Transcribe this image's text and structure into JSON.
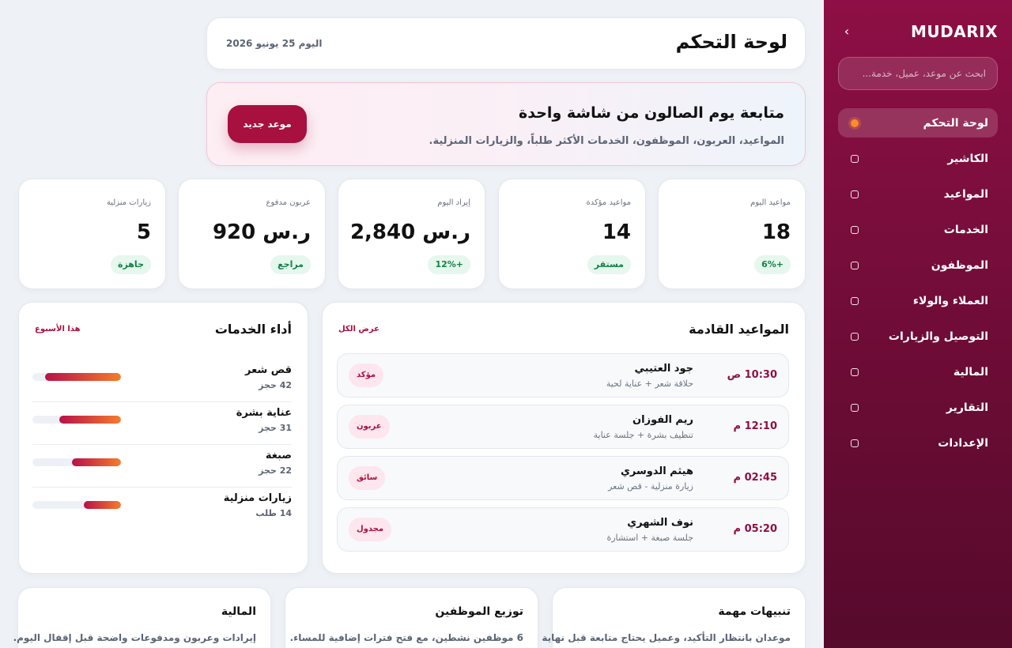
{
  "sidebar": {
    "brand": "MUDARIX",
    "collapse_icon": "chevron-right-icon",
    "search_placeholder": "ابحث عن موعد، عميل، خدمة...",
    "items": [
      {
        "label": "لوحة التحكم",
        "active": true
      },
      {
        "label": "الكاشير"
      },
      {
        "label": "المواعيد"
      },
      {
        "label": "الخدمات"
      },
      {
        "label": "الموظفون"
      },
      {
        "label": "العملاء والولاء"
      },
      {
        "label": "التوصيل والزيارات"
      },
      {
        "label": "المالية"
      },
      {
        "label": "التقارير"
      },
      {
        "label": "الإعدادات"
      }
    ]
  },
  "header": {
    "title": "لوحة التحكم",
    "date": "اليوم 25 يونيو 2026"
  },
  "hero": {
    "title": "متابعة يوم الصالون من شاشة واحدة",
    "subtitle": "المواعيد، العربون، الموظفون، الخدمات الأكثر طلباً، والزيارات المنزلية.",
    "button": "موعد جديد"
  },
  "stats": [
    {
      "label": "مواعيد اليوم",
      "value": "18",
      "badge": "+6%"
    },
    {
      "label": "مواعيد مؤكدة",
      "value": "14",
      "badge": "مستقر"
    },
    {
      "label": "إيراد اليوم",
      "value": "2,840 ر.س",
      "badge": "+12%"
    },
    {
      "label": "عربون مدفوع",
      "value": "920 ر.س",
      "badge": "مراجع"
    },
    {
      "label": "زيارات منزلية",
      "value": "5",
      "badge": "جاهزة"
    }
  ],
  "appointments": {
    "title": "المواعيد القادمة",
    "link": "عرض الكل",
    "items": [
      {
        "time": "10:30 ص",
        "name": "جود العتيبي",
        "desc": "حلاقة شعر + عناية لحية",
        "tag": "مؤكد"
      },
      {
        "time": "12:10 م",
        "name": "ريم الفوزان",
        "desc": "تنظيف بشرة + جلسة عناية",
        "tag": "عربون"
      },
      {
        "time": "02:45 م",
        "name": "هيثم الدوسري",
        "desc": "زيارة منزلية - قص شعر",
        "tag": "سائق"
      },
      {
        "time": "05:20 م",
        "name": "نوف الشهري",
        "desc": "جلسة صبغة + استشارة",
        "tag": "مجدول"
      }
    ]
  },
  "services": {
    "title": "أداء الخدمات",
    "link": "هذا الأسبوع",
    "items": [
      {
        "name": "قص شعر",
        "count": "42 حجز",
        "level": 0.86
      },
      {
        "name": "عناية بشرة",
        "count": "31 حجز",
        "level": 0.7
      },
      {
        "name": "صبغة",
        "count": "22 حجز",
        "level": 0.55
      },
      {
        "name": "زيارات منزلية",
        "count": "14 طلب",
        "level": 0.42
      }
    ]
  },
  "bottom": [
    {
      "title": "تنبيهات مهمة",
      "text": "موعدان بانتظار التأكيد، وعميل يحتاج متابعة قبل نهاية"
    },
    {
      "title": "توزيع الموظفين",
      "text": "6 موظفين نشطين، مع فتح فترات إضافية للمساء."
    },
    {
      "title": "المالية",
      "text": "إيرادات وعربون ومدفوعات واضحة قبل إقفال اليوم."
    }
  ],
  "colors": {
    "brand": "#8e0f45",
    "accent": "#a8103f",
    "dot_active": "#ff8a2a",
    "badge_green": "#14804a"
  }
}
